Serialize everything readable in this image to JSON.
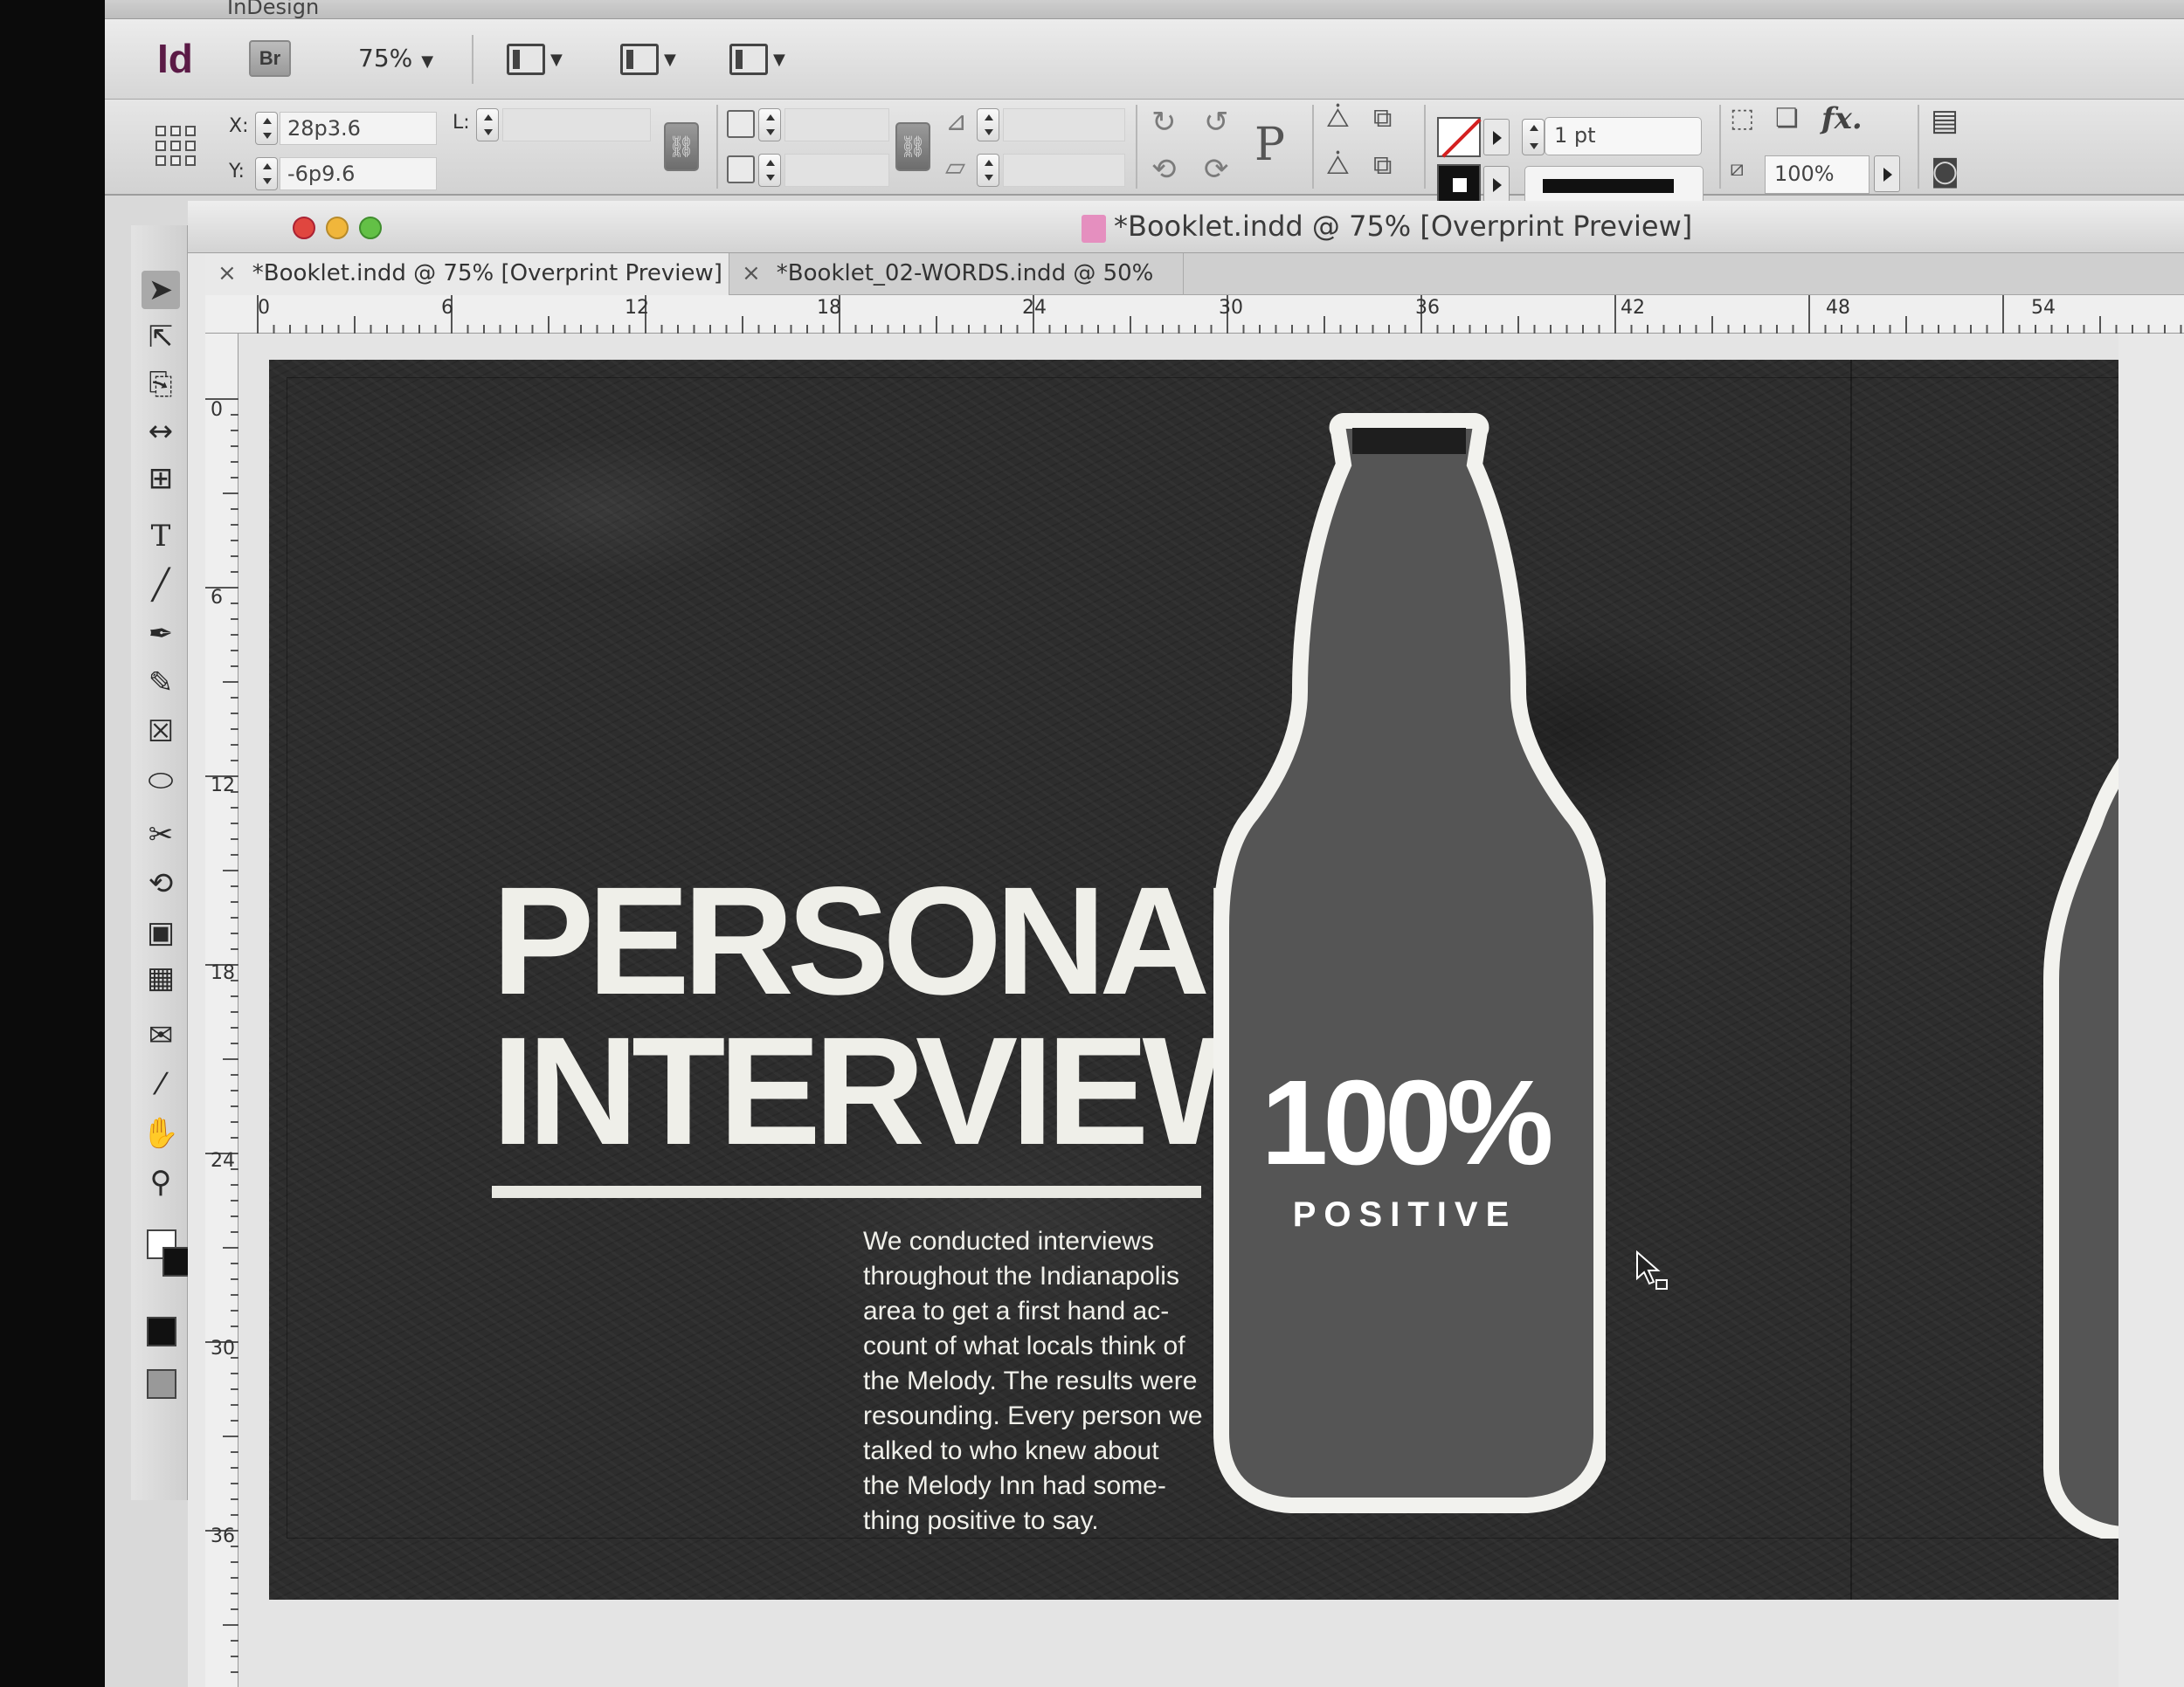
{
  "app": {
    "menu_name": "InDesign",
    "logo": "Id",
    "bridge_label": "Br",
    "zoom": "75%"
  },
  "control": {
    "x_label": "X:",
    "x_value": "28p3.6",
    "y_label": "Y:",
    "y_value": "-6p9.6",
    "l_label": "L:",
    "stroke_weight": "1 pt",
    "opacity": "100%",
    "fx_label": "fx."
  },
  "window": {
    "title": "*Booklet.indd @ 75% [Overprint Preview]"
  },
  "tabs": [
    {
      "label": "*Booklet.indd @ 75% [Overprint Preview]",
      "close": "×"
    },
    {
      "label": "*Booklet_02-WORDS.indd @ 50%",
      "close": "×"
    }
  ],
  "ruler": {
    "h_labels": [
      "0",
      "6",
      "12",
      "18",
      "24",
      "30",
      "36",
      "42",
      "48",
      "54"
    ],
    "v_labels": [
      "0",
      "6",
      "12",
      "18",
      "24",
      "30",
      "36"
    ]
  },
  "page": {
    "headline_line1": "PERSONAL",
    "headline_line2": "INTERVIEWS",
    "body_text": "We conducted interviews\nthroughout the Indianapolis\narea to get a first hand ac-\ncount of what locals think of\nthe Melody. The results were\nresounding. Every person we\ntalked to who knew about\nthe Melody Inn had some-\nthing positive to say.",
    "stat_value": "100%",
    "stat_label": "POSITIVE"
  },
  "colors": {
    "background": "#2e2e2e",
    "bottle_fill": "#555555",
    "bottle_outline": "#f2f2ee",
    "headline": "#efefe9"
  },
  "icons": {
    "tools": [
      "selection-tool-icon",
      "direct-selection-tool-icon",
      "page-tool-icon",
      "gap-tool-icon",
      "content-collector-icon",
      "type-tool-icon",
      "line-tool-icon",
      "pen-tool-icon",
      "pencil-tool-icon",
      "rectangle-frame-tool-icon",
      "ellipse-tool-icon",
      "scissors-tool-icon",
      "free-transform-tool-icon",
      "gradient-swatch-tool-icon",
      "gradient-feather-tool-icon",
      "note-tool-icon",
      "eyedropper-tool-icon",
      "hand-tool-icon",
      "zoom-tool-icon"
    ]
  }
}
